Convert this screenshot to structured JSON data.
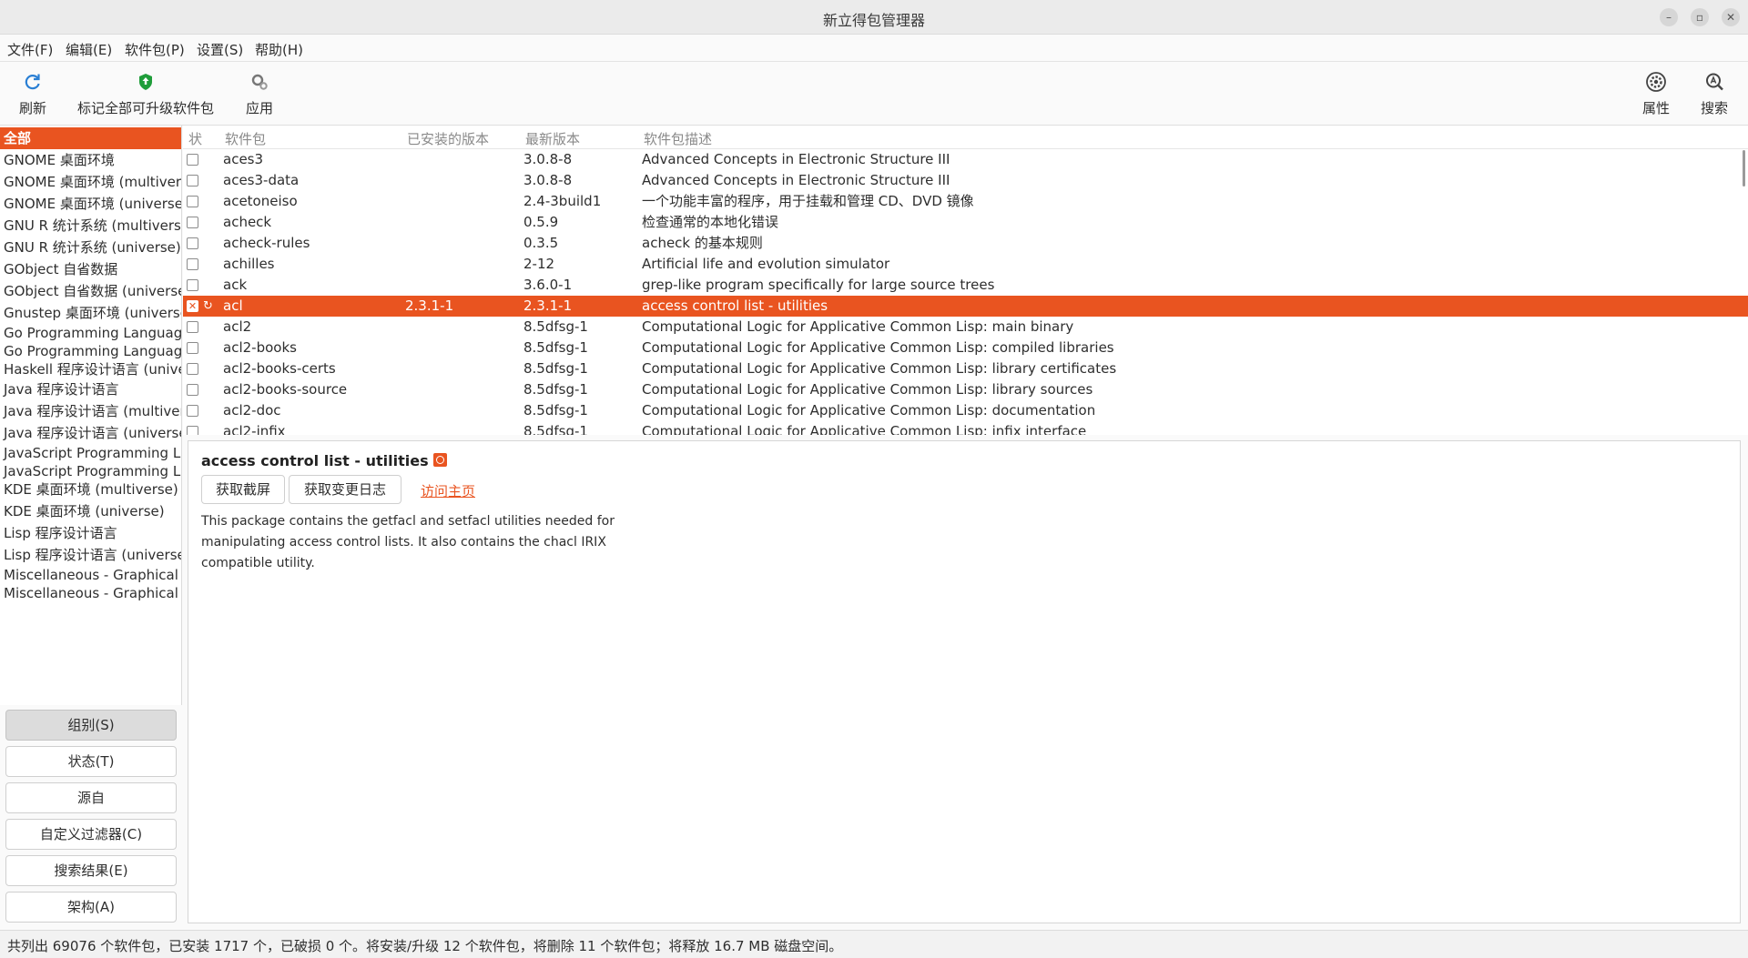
{
  "window": {
    "title": "新立得包管理器"
  },
  "menu": [
    "文件(F)",
    "编辑(E)",
    "软件包(P)",
    "设置(S)",
    "帮助(H)"
  ],
  "toolbar": {
    "reload": "刷新",
    "mark_all": "标记全部可升级软件包",
    "apply": "应用",
    "properties": "属性",
    "search": "搜索"
  },
  "sidebar": {
    "items": [
      "全部",
      "GNOME 桌面环境",
      "GNOME 桌面环境 (multiverse)",
      "GNOME 桌面环境 (universe)",
      "GNU R 统计系统 (multiverse)",
      "GNU R 统计系统 (universe)",
      "GObject 自省数据",
      "GObject 自省数据 (universe)",
      "Gnustep 桌面环境 (universe)",
      "Go Programming Language",
      "Go Programming Language (universe)",
      "Haskell 程序设计语言 (universe)",
      "Java 程序设计语言",
      "Java 程序设计语言 (multiverse)",
      "Java 程序设计语言 (universe)",
      "JavaScript Programming Language",
      "JavaScript Programming Language (universe)",
      "KDE 桌面环境 (multiverse)",
      "KDE 桌面环境 (universe)",
      "Lisp 程序设计语言",
      "Lisp 程序设计语言 (universe)",
      "Miscellaneous - Graphical",
      "Miscellaneous - Graphical (multiverse)"
    ],
    "selected": 0
  },
  "filters": [
    "组别(S)",
    "状态(T)",
    "源自",
    "自定义过滤器(C)",
    "搜索结果(E)",
    "架构(A)"
  ],
  "columns": {
    "status": "状",
    "package": "软件包",
    "installed": "已安装的版本",
    "latest": "最新版本",
    "description": "软件包描述"
  },
  "packages": [
    {
      "name": "aces3",
      "installed": "",
      "latest": "3.0.8-8",
      "desc": "Advanced Concepts in Electronic Structure III"
    },
    {
      "name": "aces3-data",
      "installed": "",
      "latest": "3.0.8-8",
      "desc": "Advanced Concepts in Electronic Structure III"
    },
    {
      "name": "acetoneiso",
      "installed": "",
      "latest": "2.4-3build1",
      "desc": "一个功能丰富的程序，用于挂载和管理 CD、DVD 镜像"
    },
    {
      "name": "acheck",
      "installed": "",
      "latest": "0.5.9",
      "desc": "检查通常的本地化错误"
    },
    {
      "name": "acheck-rules",
      "installed": "",
      "latest": "0.3.5",
      "desc": "acheck 的基本规则"
    },
    {
      "name": "achilles",
      "installed": "",
      "latest": "2-12",
      "desc": "Artificial life and evolution simulator"
    },
    {
      "name": "ack",
      "installed": "",
      "latest": "3.6.0-1",
      "desc": "grep-like program specifically for large source trees"
    },
    {
      "name": "acl",
      "installed": "2.3.1-1",
      "latest": "2.3.1-1",
      "desc": "access control list - utilities"
    },
    {
      "name": "acl2",
      "installed": "",
      "latest": "8.5dfsg-1",
      "desc": "Computational Logic for Applicative Common Lisp: main binary"
    },
    {
      "name": "acl2-books",
      "installed": "",
      "latest": "8.5dfsg-1",
      "desc": "Computational Logic for Applicative Common Lisp: compiled libraries"
    },
    {
      "name": "acl2-books-certs",
      "installed": "",
      "latest": "8.5dfsg-1",
      "desc": "Computational Logic for Applicative Common Lisp: library certificates"
    },
    {
      "name": "acl2-books-source",
      "installed": "",
      "latest": "8.5dfsg-1",
      "desc": "Computational Logic for Applicative Common Lisp: library sources"
    },
    {
      "name": "acl2-doc",
      "installed": "",
      "latest": "8.5dfsg-1",
      "desc": "Computational Logic for Applicative Common Lisp: documentation"
    },
    {
      "name": "acl2-infix",
      "installed": "",
      "latest": "8.5dfsg-1",
      "desc": "Computational Logic for Applicative Common Lisp: infix interface"
    }
  ],
  "selected_package": 7,
  "details": {
    "title": "access control list - utilities",
    "screenshot_btn": "获取截屏",
    "changelog_btn": "获取变更日志",
    "homepage_link": "访问主页",
    "description": "This package contains the getfacl and setfacl utilities needed for manipulating access control lists. It also contains the chacl IRIX compatible utility."
  },
  "status": "共列出 69076 个软件包，已安装 1717 个，已破损 0 个。将安装/升级 12 个软件包，将删除 11 个软件包；将释放 16.7 MB 磁盘空间。",
  "colors": {
    "accent": "#e95420"
  }
}
